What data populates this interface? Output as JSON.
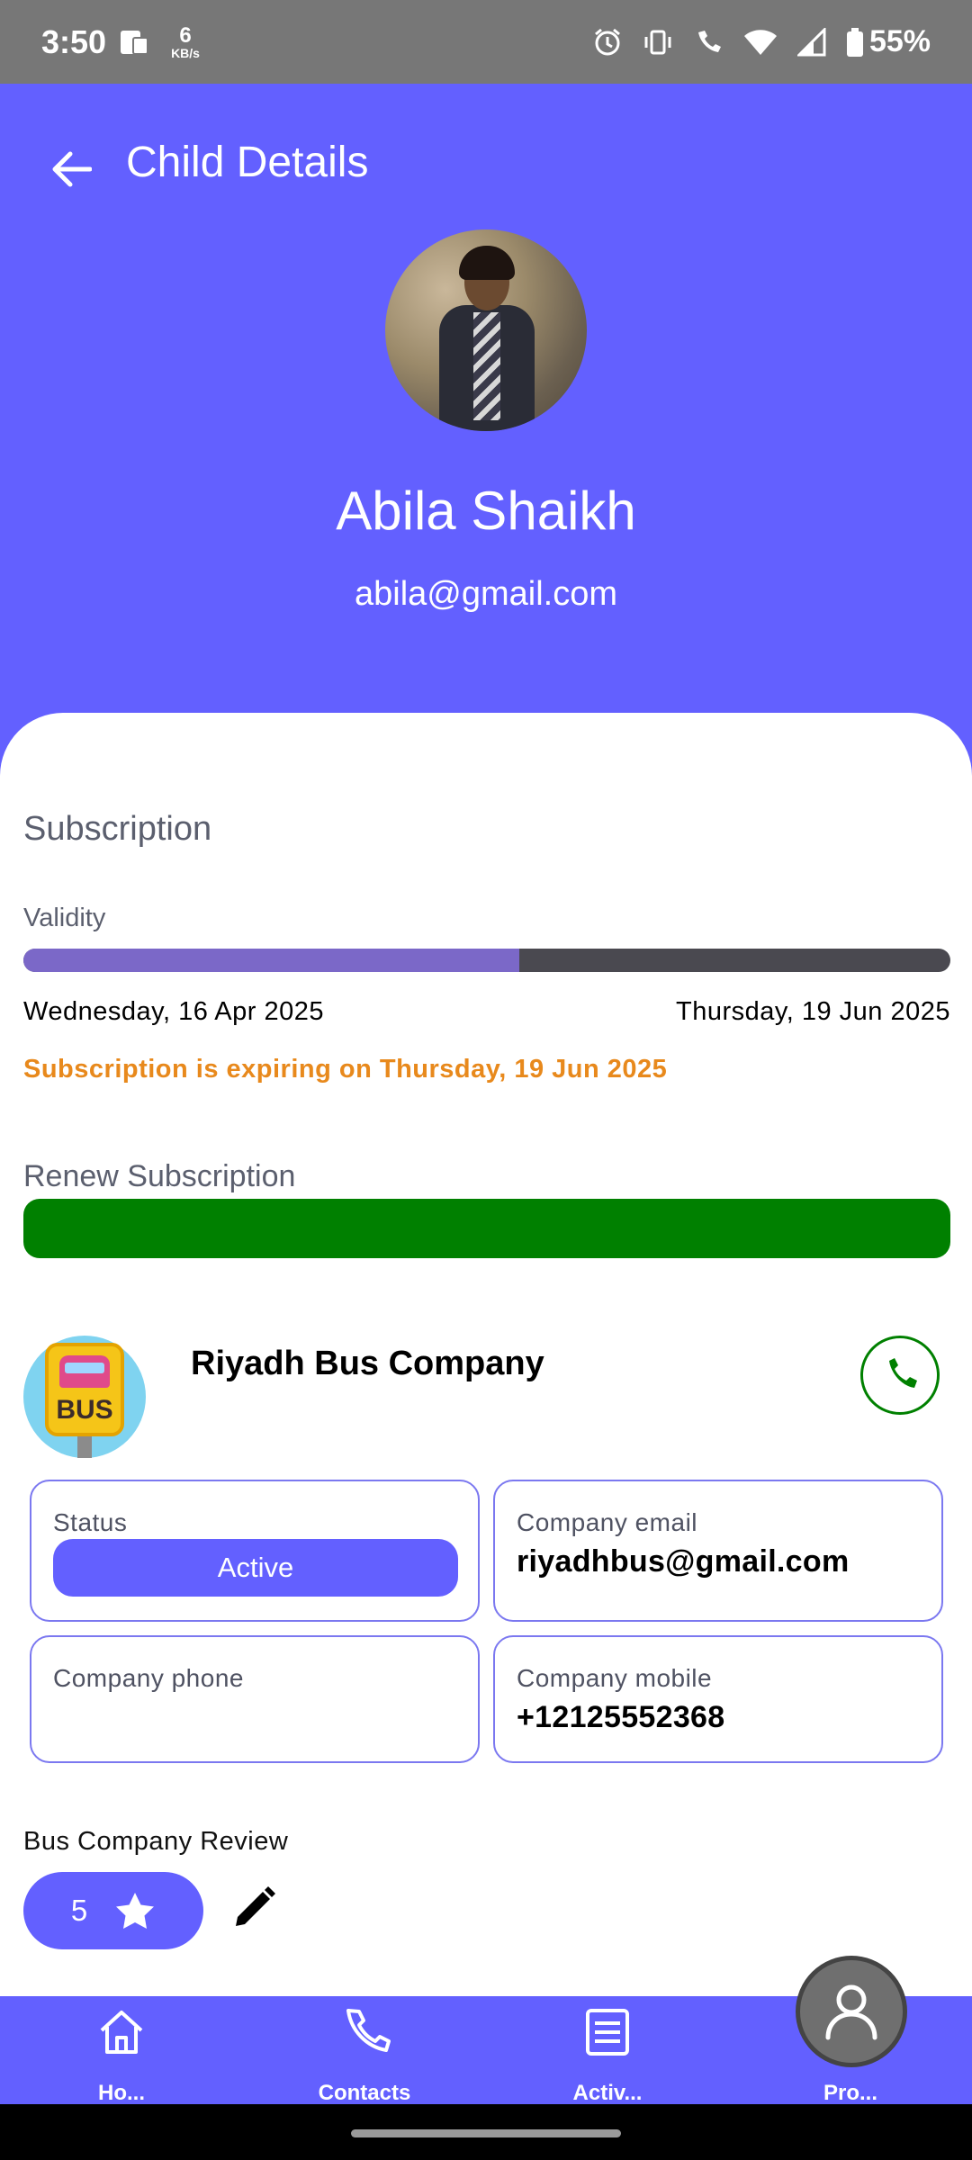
{
  "status_bar": {
    "time": "3:50",
    "net_speed": "6",
    "net_unit": "KB/s",
    "battery": "55%"
  },
  "header": {
    "title": "Child Details",
    "child_name": "Abila Shaikh",
    "child_email": "abila@gmail.com"
  },
  "subscription": {
    "title": "Subscription",
    "validity_label": "Validity",
    "progress_fraction": 0.535,
    "start_date": "Wednesday, 16 Apr 2025",
    "end_date": "Thursday, 19 Jun 2025",
    "expiry_note": "Subscription is expiring on Thursday, 19 Jun 2025",
    "renew_label": "Renew Subscription"
  },
  "company": {
    "name": "Riyadh Bus Company",
    "logo_text": "BUS",
    "status_label": "Status",
    "status_value": "Active",
    "email_label": "Company email",
    "email_value": "riyadhbus@gmail.com",
    "phone_label": "Company phone",
    "phone_value": "",
    "mobile_label": "Company mobile",
    "mobile_value": "+12125552368"
  },
  "review": {
    "label": "Bus Company Review",
    "rating": "5"
  },
  "bottom_nav": {
    "items": [
      {
        "label": "Ho...",
        "icon": "home-icon"
      },
      {
        "label": "Contacts",
        "icon": "phone-icon"
      },
      {
        "label": "Activ...",
        "icon": "list-icon"
      },
      {
        "label": "Pro...",
        "icon": "profile-icon"
      }
    ]
  },
  "colors": {
    "primary": "#6360FF",
    "renew_green": "#008000",
    "warning_orange": "#E8891C",
    "progress_fill": "#7B68C8"
  }
}
